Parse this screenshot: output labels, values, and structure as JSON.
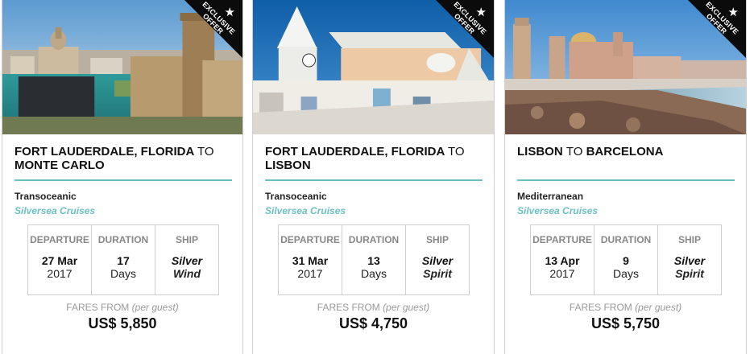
{
  "badge": {
    "line1": "EXCLUSIVE",
    "line2": "OFFER"
  },
  "cards": [
    {
      "from": "FORT LAUDERDALE, FLORIDA",
      "to_word": "TO",
      "dest": "MONTE CARLO",
      "region": "Transoceanic",
      "cruise_line": "Silversea Cruises",
      "headers": {
        "departure": "DEPARTURE",
        "duration": "DURATION",
        "ship": "SHIP"
      },
      "departure": {
        "day": "27 Mar",
        "year": "2017"
      },
      "duration": {
        "num": "17",
        "unit": "Days"
      },
      "ship": {
        "line1": "Silver",
        "line2": "Wind"
      },
      "fares_label": "FARES FROM",
      "per_guest": "(per guest)",
      "price": "US$ 5,850"
    },
    {
      "from": "FORT LAUDERDALE, FLORIDA",
      "to_word": "TO",
      "dest": "LISBON",
      "region": "Transoceanic",
      "cruise_line": "Silversea Cruises",
      "headers": {
        "departure": "DEPARTURE",
        "duration": "DURATION",
        "ship": "SHIP"
      },
      "departure": {
        "day": "31 Mar",
        "year": "2017"
      },
      "duration": {
        "num": "13",
        "unit": "Days"
      },
      "ship": {
        "line1": "Silver",
        "line2": "Spirit"
      },
      "fares_label": "FARES FROM",
      "per_guest": "(per guest)",
      "price": "US$ 4,750"
    },
    {
      "from": "LISBON",
      "to_word": "TO",
      "dest": "BARCELONA",
      "region": "Mediterranean",
      "cruise_line": "Silversea Cruises",
      "headers": {
        "departure": "DEPARTURE",
        "duration": "DURATION",
        "ship": "SHIP"
      },
      "departure": {
        "day": "13 Apr",
        "year": "2017"
      },
      "duration": {
        "num": "9",
        "unit": "Days"
      },
      "ship": {
        "line1": "Silver",
        "line2": "Spirit"
      },
      "fares_label": "FARES FROM",
      "per_guest": "(per guest)",
      "price": "US$ 5,750"
    }
  ],
  "colors": {
    "accent": "#6cc0c3",
    "badge_bg": "#0b0b0b",
    "border": "#cfcfcf",
    "muted": "#888888"
  }
}
